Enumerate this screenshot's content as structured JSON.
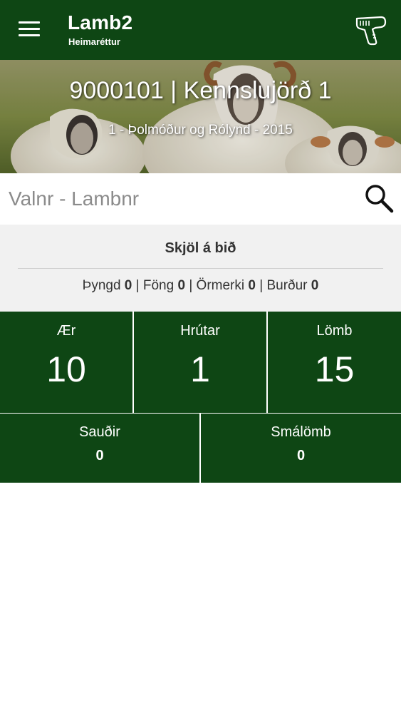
{
  "app_bar": {
    "title": "Lamb2",
    "subtitle": "Heimaréttur",
    "menu_icon": "hamburger-menu-icon",
    "scanner_icon": "barcode-scanner-icon",
    "background_color": "#0e4614"
  },
  "hero": {
    "title": "9000101 | Kennslujörð 1",
    "subtitle": "1 - Þolmóður og Rólynd - 2015"
  },
  "search": {
    "placeholder": "Valnr - Lambnr",
    "value": "",
    "icon": "search-icon"
  },
  "pending": {
    "title": "Skjöl á bið",
    "items": [
      {
        "label": "Þyngd",
        "count": "0"
      },
      {
        "label": "Föng",
        "count": "0"
      },
      {
        "label": "Örmerki",
        "count": "0"
      },
      {
        "label": "Burður",
        "count": "0"
      }
    ],
    "separator": "|"
  },
  "stats_primary": [
    {
      "label": "Ær",
      "value": "10"
    },
    {
      "label": "Hrútar",
      "value": "1"
    },
    {
      "label": "Lömb",
      "value": "15"
    }
  ],
  "stats_secondary": [
    {
      "label": "Sauðir",
      "value": "0"
    },
    {
      "label": "Smálömb",
      "value": "0"
    }
  ]
}
